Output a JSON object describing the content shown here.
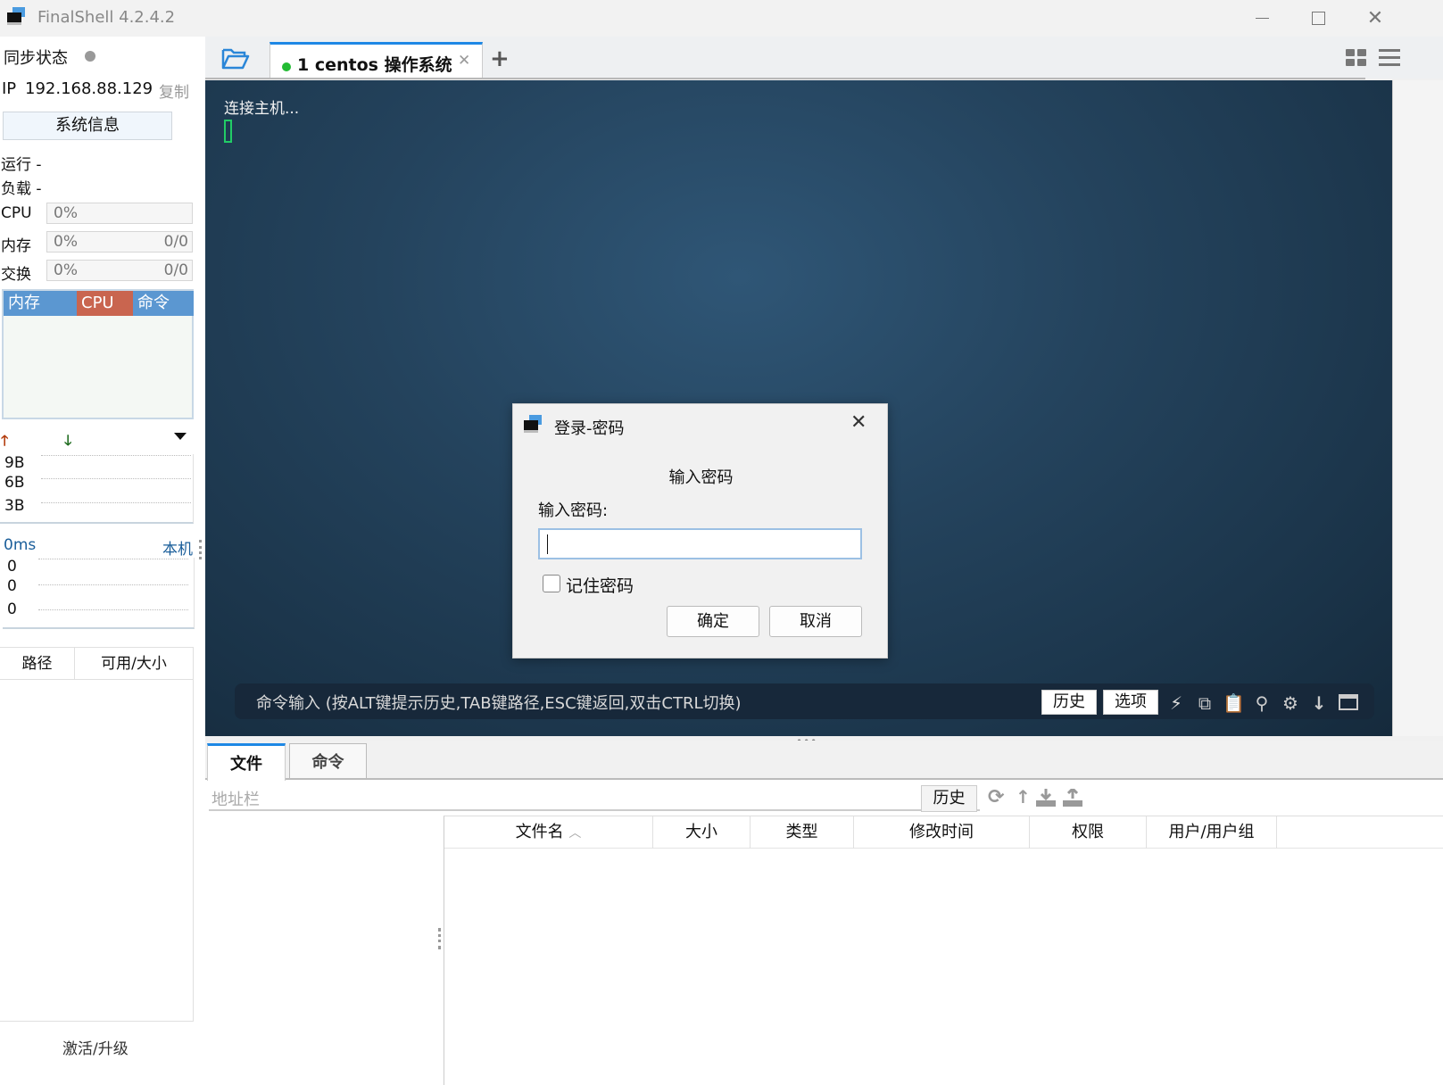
{
  "window": {
    "title": "FinalShell 4.2.4.2",
    "minimize_icon": "minimize-icon",
    "maximize_icon": "maximize-icon",
    "close_icon": "close-icon"
  },
  "sidebar": {
    "sync_label": "同步状态",
    "ip_label": "IP",
    "ip_value": "192.168.88.129",
    "copy_label": "复制",
    "sysinfo_button": "系统信息",
    "uptime_label": "运行 -",
    "load_label": "负载 -",
    "cpu": {
      "label": "CPU",
      "percent": "0%"
    },
    "mem": {
      "label": "内存",
      "percent": "0%",
      "value": "0/0"
    },
    "swap": {
      "label": "交换",
      "percent": "0%",
      "value": "0/0"
    },
    "process_tabs": [
      {
        "label": "内存",
        "color": "#5b97d1"
      },
      {
        "label": "CPU",
        "color": "#c9654f"
      },
      {
        "label": "命令",
        "color": "#5b97d1"
      }
    ],
    "net": {
      "ticks": [
        "9B",
        "6B",
        "3B"
      ],
      "up_color": "#b23a0a",
      "down_color": "#1e6b1e"
    },
    "ping": {
      "value": "0ms",
      "host": "本机",
      "ticks": [
        "0",
        "0",
        "0"
      ]
    },
    "disk_headers": [
      "路径",
      "可用/大小"
    ],
    "activate_label": "激活/升级"
  },
  "tabs": {
    "items": [
      {
        "label": "1 centos 操作系统",
        "status_color": "#22bb33",
        "active": true
      }
    ],
    "add_icon": "plus-icon"
  },
  "terminal": {
    "text": "连接主机...",
    "cursor_color": "#22cc66",
    "command_placeholder": "命令输入 (按ALT键提示历史,TAB键路径,ESC键返回,双击CTRL切换)",
    "history_button": "历史",
    "options_button": "选项"
  },
  "dialog": {
    "title": "登录-密码",
    "heading": "输入密码",
    "field_label": "输入密码:",
    "password_value": "",
    "remember_label": "记住密码",
    "remember_checked": false,
    "ok_button": "确定",
    "cancel_button": "取消"
  },
  "files": {
    "tabs": [
      "文件",
      "命令"
    ],
    "address_placeholder": "地址栏",
    "history_button": "历史",
    "columns": [
      "文件名",
      "大小",
      "类型",
      "修改时间",
      "权限",
      "用户/用户组"
    ],
    "sort_indicator": "^",
    "accent_color": "#1e88e5"
  }
}
